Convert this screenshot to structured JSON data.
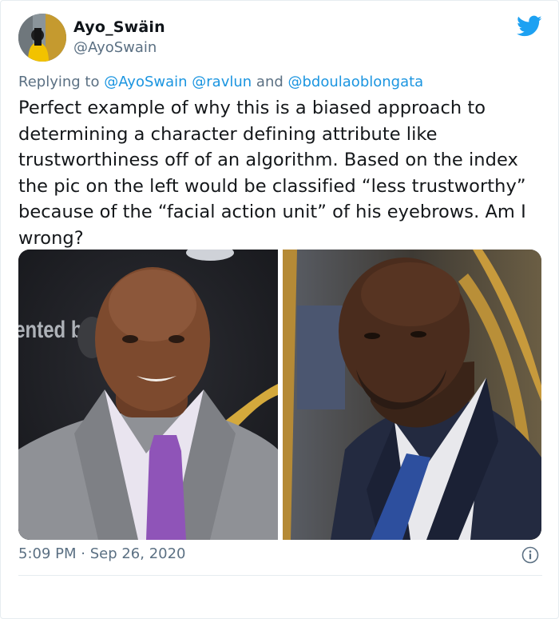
{
  "author": {
    "name": "Ayo_Swäin",
    "handle": "@AyoSwain"
  },
  "reply": {
    "prefix": "Replying to ",
    "mentions": [
      "@AyoSwain",
      "@ravlun",
      "@bdoulaoblongata"
    ],
    "joiner": " and "
  },
  "tweet": {
    "text": "Perfect example of why this is a biased approach to determining a character defining attribute like trustworthiness off of an algorithm. Based on the index the pic on the left would be classified “less trustworthy” because of the “facial action unit” of his eyebrows. Am I wrong?"
  },
  "photos": {
    "left_backdrop_text": "ented by"
  },
  "meta": {
    "time": "5:09 PM",
    "separator": " · ",
    "date": "Sep 26, 2020"
  },
  "icons": {
    "brand": "twitter-bird-icon",
    "info": "info-icon"
  },
  "colors": {
    "brand": "#1da1f2",
    "link": "#1b95e0",
    "secondary": "#5b7083",
    "text": "#14171a"
  }
}
